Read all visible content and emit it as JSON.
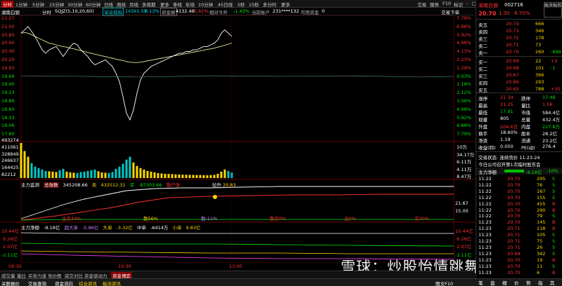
{
  "topbar": {
    "badge": "分时",
    "periods": [
      "1分钟",
      "5分钟",
      "15分钟",
      "30分钟",
      "60分钟",
      "日线",
      "周线",
      "月线",
      "多周期",
      "更多",
      "季线",
      "年线",
      "10分钟",
      "45日线",
      "5秒",
      "15秒",
      "多分时",
      "更多"
    ],
    "right_items": [
      "交易",
      "服务",
      "F10",
      "标记",
      "-",
      "□",
      "×"
    ]
  },
  "inforow": {
    "stock": "湖南白银",
    "mode": "分时",
    "indicator": "SQJZ(5,10,20,60)",
    "flow_label": "深证成指",
    "flow_value": "14361.59",
    "flow_pct": "0.13%",
    "capital_label": "资金报",
    "capital_value": "4132.48",
    "capital_pct": "5.61%",
    "relative_label": "相对今开",
    "relative_value": "-1.43%",
    "account_label": "当前账户",
    "account_value": "231****132",
    "cash_label": "可用资金",
    "cash_value": "0",
    "trade_order": "交易下单"
  },
  "axes": {
    "left_price": [
      "21.27",
      "21.00",
      "20.80",
      "20.60",
      "20.40",
      "20.20",
      "19.93",
      "19.66",
      "19.40",
      "19.13",
      "18.86",
      "18.60",
      "18.33",
      "18.06",
      "17.80"
    ],
    "right_pct": [
      "7.79%",
      "6.88%",
      "5.92%",
      "4.98%",
      "4.13%",
      "2.23%",
      "1.29%",
      "0.03%",
      "1.18%",
      "2.12%",
      "3.06%",
      "4.98%",
      "5.92%",
      "6.88%",
      "7.79%"
    ],
    "left_vol": [
      "493274",
      "411061",
      "328849",
      "246637",
      "164425",
      "82212"
    ],
    "right_vol": [
      "10万",
      "34.17万",
      "6.11万",
      "4.11万",
      "8.47万"
    ],
    "time_ticks": [
      "09:30",
      "10:30",
      "13:00"
    ]
  },
  "zhuli": {
    "title": "主力监测",
    "total_label": "总张数",
    "total_value": "345208.66",
    "buy_label": "卖",
    "buy_value": "432512.31",
    "sell_label": "买",
    "sell_value": "-87303.66",
    "bar_label": "散户张",
    "pull_label": "拉升",
    "pull_value": "20.83",
    "axis_hi": "21.67",
    "axis_lo": "15.00",
    "pct_labels": [
      "主买44%",
      "散56%",
      "散-11%",
      "散买0%",
      "出0%",
      "买20%"
    ]
  },
  "net": {
    "title": "主力净额",
    "total": "-9.18亿",
    "super_label": "超大单",
    "super_value": "-5.86亿",
    "large_label": "大单",
    "large_value": "-3.32亿",
    "mid_label": "中单",
    "mid_value": "-6414万",
    "small_label": "小单",
    "small_value": "9.83亿",
    "left_axis": [
      "10.44亿",
      "6.26亿",
      "2.07亿",
      "-2.11亿"
    ],
    "right_axis": [
      "10.44亿",
      "6.26亿",
      "2.07亿",
      "-2.11亿"
    ]
  },
  "bottomtabs": [
    "成交量",
    "量比",
    "买卖力道",
    "竞价图",
    "成交对比",
    "资金驱动力",
    "资金博弈"
  ],
  "statusbar": {
    "items": [
      "关联报价",
      "交易查询",
      "资金流向",
      "综合资讯",
      "板块资讯"
    ],
    "right": "图文F10"
  },
  "watermark": "雪球：炒股怡情跳舞高手",
  "right": {
    "name": "湖南白银",
    "code": "002716",
    "price": "20.70",
    "change": "1.30",
    "pct": "6.70%",
    "ask_btn": "融资融券",
    "asks": [
      {
        "label": "卖五",
        "price": "20.74",
        "vol": "666"
      },
      {
        "label": "卖四",
        "price": "20.73",
        "vol": "346"
      },
      {
        "label": "卖三",
        "price": "20.72",
        "vol": "178"
      },
      {
        "label": "卖二",
        "price": "20.71",
        "vol": "73"
      },
      {
        "label": "卖一",
        "price": "20.70",
        "vol": "260",
        "diff": "-699"
      }
    ],
    "bids": [
      {
        "label": "买一",
        "price": "20.69",
        "vol": "22",
        "diff": "+2"
      },
      {
        "label": "买二",
        "price": "20.68",
        "vol": "101",
        "diff": "-1"
      },
      {
        "label": "买三",
        "price": "20.67",
        "vol": "366"
      },
      {
        "label": "买四",
        "price": "20.66",
        "vol": "293"
      },
      {
        "label": "买五",
        "price": "20.65",
        "vol": "788",
        "diff": "+35"
      }
    ],
    "stats": [
      {
        "l1": "涨停",
        "v1": "21.34",
        "l2": "跌停",
        "v2": "17.46"
      },
      {
        "l1": "最高",
        "v1": "21.25",
        "l2": "量比",
        "v2": "1.56"
      },
      {
        "l1": "最低",
        "v1": "17.91",
        "l2": "市值",
        "v2": "584.4亿"
      },
      {
        "l1": "现量",
        "v1": "805",
        "l2": "总量",
        "v2": "432.4万"
      },
      {
        "l1": "外盘",
        "v1": "204.6万",
        "l2": "内盘",
        "v2": "227.8万"
      },
      {
        "l1": "换手",
        "v1": "18.60%",
        "l2": "股本",
        "v2": "28.2亿"
      },
      {
        "l1": "净资",
        "v1": "1.19",
        "l2": "流通",
        "v2": "23.2亿"
      },
      {
        "l1": "收益(四)",
        "v1": "0.050",
        "l2": "PE(动)",
        "v2": "276.4"
      }
    ],
    "auction": "交易状态: 连续竞价 11:23:24",
    "notice": "今日公司召开第1次临时股东会",
    "net_label": "主力净额",
    "net_value": "-9.18亿",
    "net_pct": "-10%",
    "ticks": [
      {
        "t": "11:22",
        "p": "20.70",
        "v": "295",
        "s": "S"
      },
      {
        "t": "11:22",
        "p": "20.70",
        "v": "76",
        "s": "S"
      },
      {
        "t": "11:22",
        "p": "20.70",
        "v": "167",
        "s": "S"
      },
      {
        "t": "11:22",
        "p": "20.70",
        "v": "155",
        "s": "S"
      },
      {
        "t": "11:22",
        "p": "20.70",
        "v": "455",
        "s": "B"
      },
      {
        "t": "11:22",
        "p": "20.70",
        "v": "290",
        "s": "B"
      },
      {
        "t": "11:22",
        "p": "20.70",
        "v": "79",
        "s": "S"
      },
      {
        "t": "11:23",
        "p": "20.70",
        "v": "145",
        "s": "B"
      },
      {
        "t": "11:23",
        "p": "20.71",
        "v": "118",
        "s": "B"
      },
      {
        "t": "11:23",
        "p": "20.71",
        "v": "105",
        "s": "S"
      },
      {
        "t": "11:23",
        "p": "20.71",
        "v": "75",
        "s": "S"
      },
      {
        "t": "11:23",
        "p": "20.71",
        "v": "26",
        "s": "S"
      },
      {
        "t": "11:23",
        "p": "20.69",
        "v": "342",
        "s": "S"
      },
      {
        "t": "11:23",
        "p": "20.70",
        "v": "19",
        "s": "B"
      },
      {
        "t": "11:23",
        "p": "20.70",
        "v": "11",
        "s": "S"
      },
      {
        "t": "11:23",
        "p": "20.70",
        "v": "6",
        "s": "B"
      }
    ],
    "foot": [
      "笔",
      "盘",
      "细",
      "价",
      "势",
      "指",
      "其"
    ]
  },
  "chart_data": {
    "type": "line",
    "price_series": [
      20.8,
      20.9,
      21.0,
      20.85,
      20.7,
      20.5,
      20.3,
      20.2,
      20.3,
      20.35,
      20.4,
      20.25,
      20.1,
      20.25,
      20.4,
      20.5,
      20.45,
      20.3,
      20.2,
      20.1,
      19.95,
      19.85,
      19.9,
      19.95,
      20.0,
      19.9,
      19.8,
      19.6,
      19.35,
      18.9,
      18.4,
      18.2,
      18.5,
      19.0,
      19.4,
      19.6,
      19.7,
      19.8,
      19.85,
      19.9,
      19.95,
      20.0,
      20.05,
      20.1,
      20.15,
      20.2,
      20.2,
      20.25,
      20.25,
      20.3,
      20.3,
      20.35,
      20.4,
      20.4,
      20.45,
      20.5,
      20.6,
      20.8,
      20.9,
      20.8,
      20.7
    ],
    "avg_series": [
      20.8,
      20.82,
      20.8,
      20.75,
      20.7,
      20.65,
      20.6,
      20.55,
      20.5,
      20.48,
      20.45,
      20.42,
      20.4,
      20.38,
      20.35,
      20.33,
      20.3,
      20.28,
      20.25,
      20.22,
      20.2,
      20.17,
      20.15,
      20.12,
      20.1,
      20.07,
      20.05,
      20.02,
      20.0,
      19.98,
      19.95,
      19.93,
      19.92,
      19.92,
      19.93,
      19.95,
      19.97,
      19.99,
      20.01,
      20.03,
      20.05,
      20.07,
      20.09,
      20.11,
      20.13,
      20.15,
      20.17,
      20.19,
      20.21,
      20.23,
      20.25,
      20.27,
      20.29,
      20.31,
      20.33,
      20.35,
      20.38,
      20.41,
      20.44,
      20.47,
      20.5
    ],
    "volume": [
      493274,
      380000,
      300000,
      210000,
      160000,
      140000,
      120000,
      100000,
      95000,
      90000,
      85000,
      110000,
      130000,
      90000,
      80000,
      75000,
      70000,
      85000,
      90000,
      100000,
      110000,
      120000,
      95000,
      80000,
      75000,
      70000,
      85000,
      130000,
      160000,
      200000,
      260000,
      300000,
      220000,
      170000,
      140000,
      120000,
      100000,
      90000,
      80000,
      70000,
      65000,
      60000,
      58000,
      55000,
      52000,
      50000,
      48000,
      46000,
      45000,
      44000,
      43000,
      42000,
      41000,
      40000,
      42000,
      45000,
      60000,
      90000,
      120000,
      100000,
      80000
    ],
    "xlim": [
      "09:30",
      "13:00"
    ],
    "ylim": [
      17.8,
      21.27
    ]
  }
}
